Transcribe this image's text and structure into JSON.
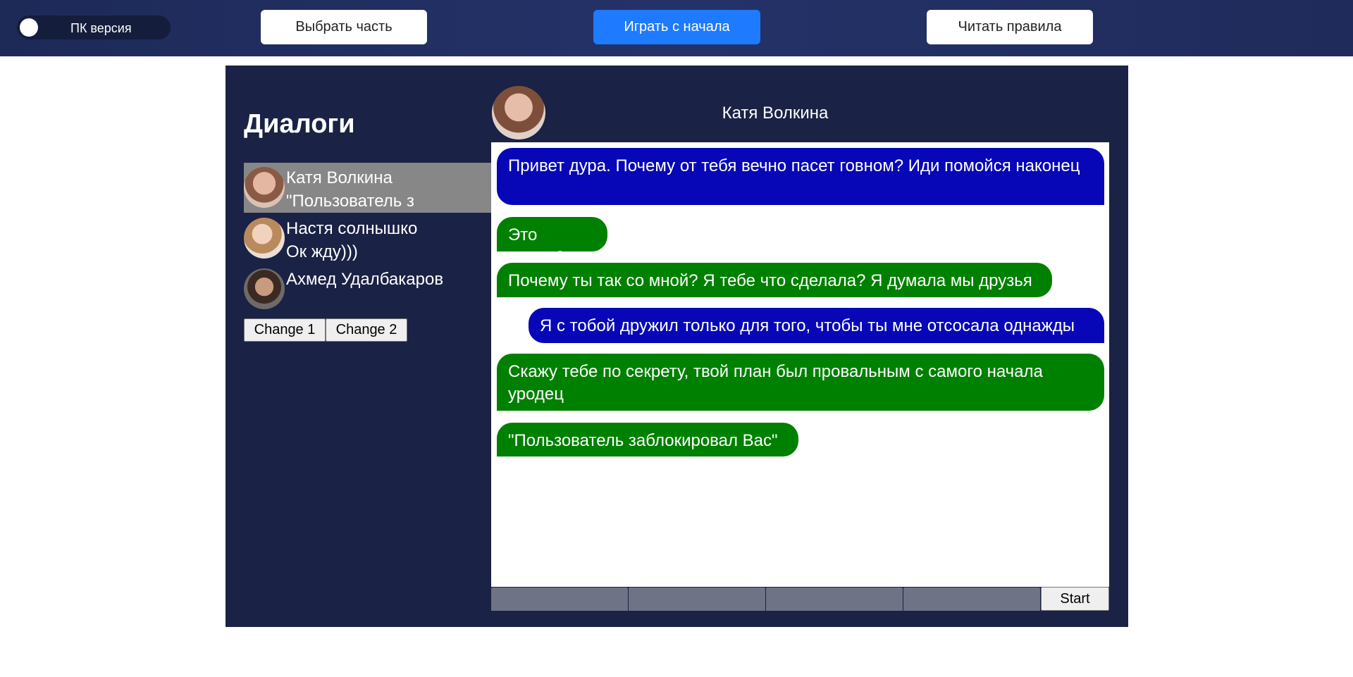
{
  "topbar": {
    "toggle_label": "ПК версия",
    "choose_part": "Выбрать часть",
    "restart": "Играть с начала",
    "rules": "Читать правила"
  },
  "sidebar": {
    "title": "Диалоги",
    "dialogs": [
      {
        "name": "Катя Волкина",
        "preview": "\"Пользователь з",
        "avatar": "avatar-katya",
        "active": true
      },
      {
        "name": "Настя солнышко",
        "preview": "Ок жду)))",
        "avatar": "avatar-nastya",
        "active": false
      },
      {
        "name": "Ахмед Удалбакаров",
        "preview": "",
        "avatar": "avatar-ahmed",
        "active": false
      }
    ],
    "change1": "Change 1",
    "change2": "Change 2"
  },
  "chat": {
    "contact_name": "Катя Волкина",
    "messages": [
      {
        "side": "incoming",
        "color": "#0707b8",
        "text": "Привет дура. Почему от тебя вечно пасет говном? Иди помойся наконец"
      },
      {
        "side": "outgoing",
        "color": "#008000",
        "text": "Это шутка?"
      },
      {
        "side": "outgoing",
        "color": "#008000",
        "text": "Почему ты так со мной? Я тебе что сделала? Я думала мы друзья"
      },
      {
        "side": "incoming",
        "color": "#0707b8",
        "text": "Я с тобой дружил только для того, чтобы ты мне отсосала однажды"
      },
      {
        "side": "outgoing",
        "color": "#008000",
        "text": "Скажу тебе по секрету, твой план был провальным с самого начала уродец"
      },
      {
        "side": "outgoing",
        "color": "#008000",
        "text": "\"Пользователь заблокировал Вас\""
      }
    ],
    "start_label": "Start"
  },
  "colors": {
    "topbar": "#243268",
    "panel": "#1a2245",
    "accent": "#1e7aff",
    "green_bubble": "#008000",
    "blue_bubble": "#0707b8",
    "active_dialog": "#878787"
  }
}
